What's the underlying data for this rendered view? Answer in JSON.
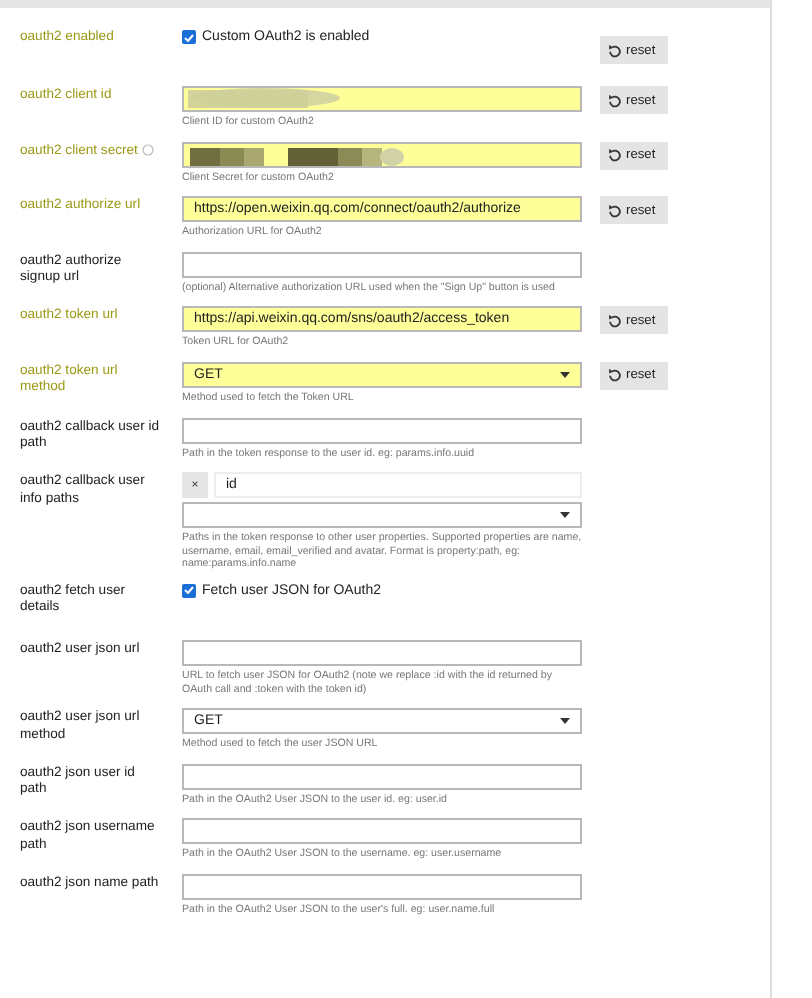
{
  "settings": [
    {
      "kind": "checkbox",
      "label": "oauth2 enabled",
      "modified": true,
      "checked": true,
      "text": "Custom OAuth2 is enabled",
      "reset": "reset"
    },
    {
      "kind": "redacted",
      "label": "oauth2 client id",
      "modified": true,
      "hint": "Client ID for custom OAuth2",
      "reset": "reset"
    },
    {
      "kind": "redacted",
      "label": "oauth2 client secret",
      "modified": true,
      "help": true,
      "hint": "Client Secret for custom OAuth2",
      "reset": "reset"
    },
    {
      "kind": "text",
      "label": "oauth2 authorize url",
      "modified": true,
      "value": "https://open.weixin.qq.com/connect/oauth2/authorize",
      "hint": "Authorization URL for OAuth2",
      "reset": "reset"
    },
    {
      "kind": "text",
      "label": "oauth2 authorize signup url",
      "modified": false,
      "hint": "(optional) Alternative authorization URL used when the \"Sign Up\" button is used"
    },
    {
      "kind": "text",
      "label": "oauth2 token url",
      "modified": true,
      "value": "https://api.weixin.qq.com/sns/oauth2/access_token",
      "hint": "Token URL for OAuth2",
      "reset": "reset"
    },
    {
      "kind": "select",
      "label": "oauth2 token url method",
      "modified": true,
      "value": "GET",
      "hint": "Method used to fetch the Token URL",
      "reset": "reset"
    },
    {
      "kind": "text",
      "label": "oauth2 callback user id path",
      "modified": false,
      "hint": "Path in the token response to the user id. eg: params.info.uuid"
    },
    {
      "kind": "tags",
      "label": "oauth2 callback user info paths",
      "modified": false,
      "remove": "×",
      "tags": [
        "id"
      ],
      "hint": "Paths in the token response to other user properties. Supported properties are name, username, email, email_verified and avatar. Format is property:path, eg: name:params.info.name"
    },
    {
      "kind": "checkbox",
      "label": "oauth2 fetch user details",
      "modified": false,
      "checked": true,
      "text": "Fetch user JSON for OAuth2"
    },
    {
      "kind": "text",
      "label": "oauth2 user json url",
      "modified": false,
      "hint": "URL to fetch user JSON for OAuth2 (note we replace :id with the id returned by OAuth call and :token with the token id)"
    },
    {
      "kind": "select",
      "label": "oauth2 user json url method",
      "modified": false,
      "value": "GET",
      "hint": "Method used to fetch the user JSON URL"
    },
    {
      "kind": "text",
      "label": "oauth2 json user id path",
      "modified": false,
      "hint": "Path in the OAuth2 User JSON to the user id. eg: user.id"
    },
    {
      "kind": "text",
      "label": "oauth2 json username path",
      "modified": false,
      "hint": "Path in the OAuth2 User JSON to the username. eg: user.username"
    },
    {
      "kind": "text",
      "label": "oauth2 json name path",
      "modified": false,
      "hint": "Path in the OAuth2 User JSON to the user's full. eg: user.name.full"
    }
  ]
}
